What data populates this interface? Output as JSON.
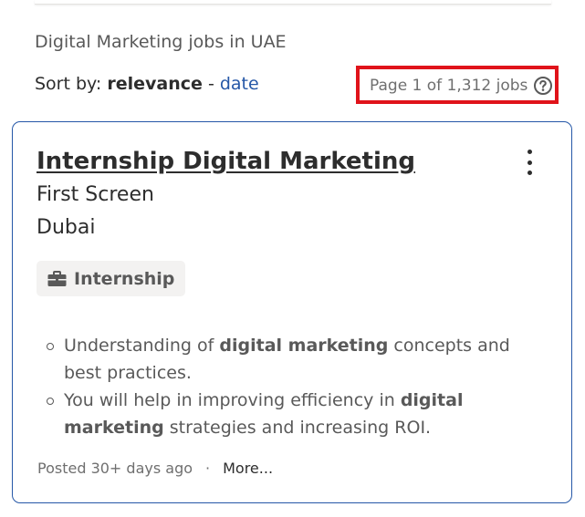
{
  "results": {
    "heading": "Digital Marketing jobs in UAE",
    "sort_prefix": "Sort by: ",
    "sort_active": "relevance",
    "sort_separator": " - ",
    "sort_alt": "date",
    "page_count": "Page 1 of 1,312 jobs"
  },
  "job": {
    "title": "Internship Digital Marketing",
    "company": "First Screen",
    "location": "Dubai",
    "job_type": "Internship",
    "snippet": [
      {
        "before": "Understanding of ",
        "bold": "digital marketing",
        "after": " concepts and best practices."
      },
      {
        "before": "You will help in improving efficiency in ",
        "bold": "digital marketing",
        "after": " strategies and increasing ROI."
      }
    ],
    "posted": "Posted 30+ days ago",
    "separator": "·",
    "more": "More..."
  },
  "colors": {
    "accent_link": "#2557a7",
    "highlight_box": "#e0131a",
    "card_border": "#2557a7",
    "text_primary": "#2d2d2d",
    "text_secondary": "#595959"
  },
  "icons": {
    "help": "help-circle-icon",
    "job_type": "briefcase-icon",
    "menu": "more-vertical-icon"
  }
}
